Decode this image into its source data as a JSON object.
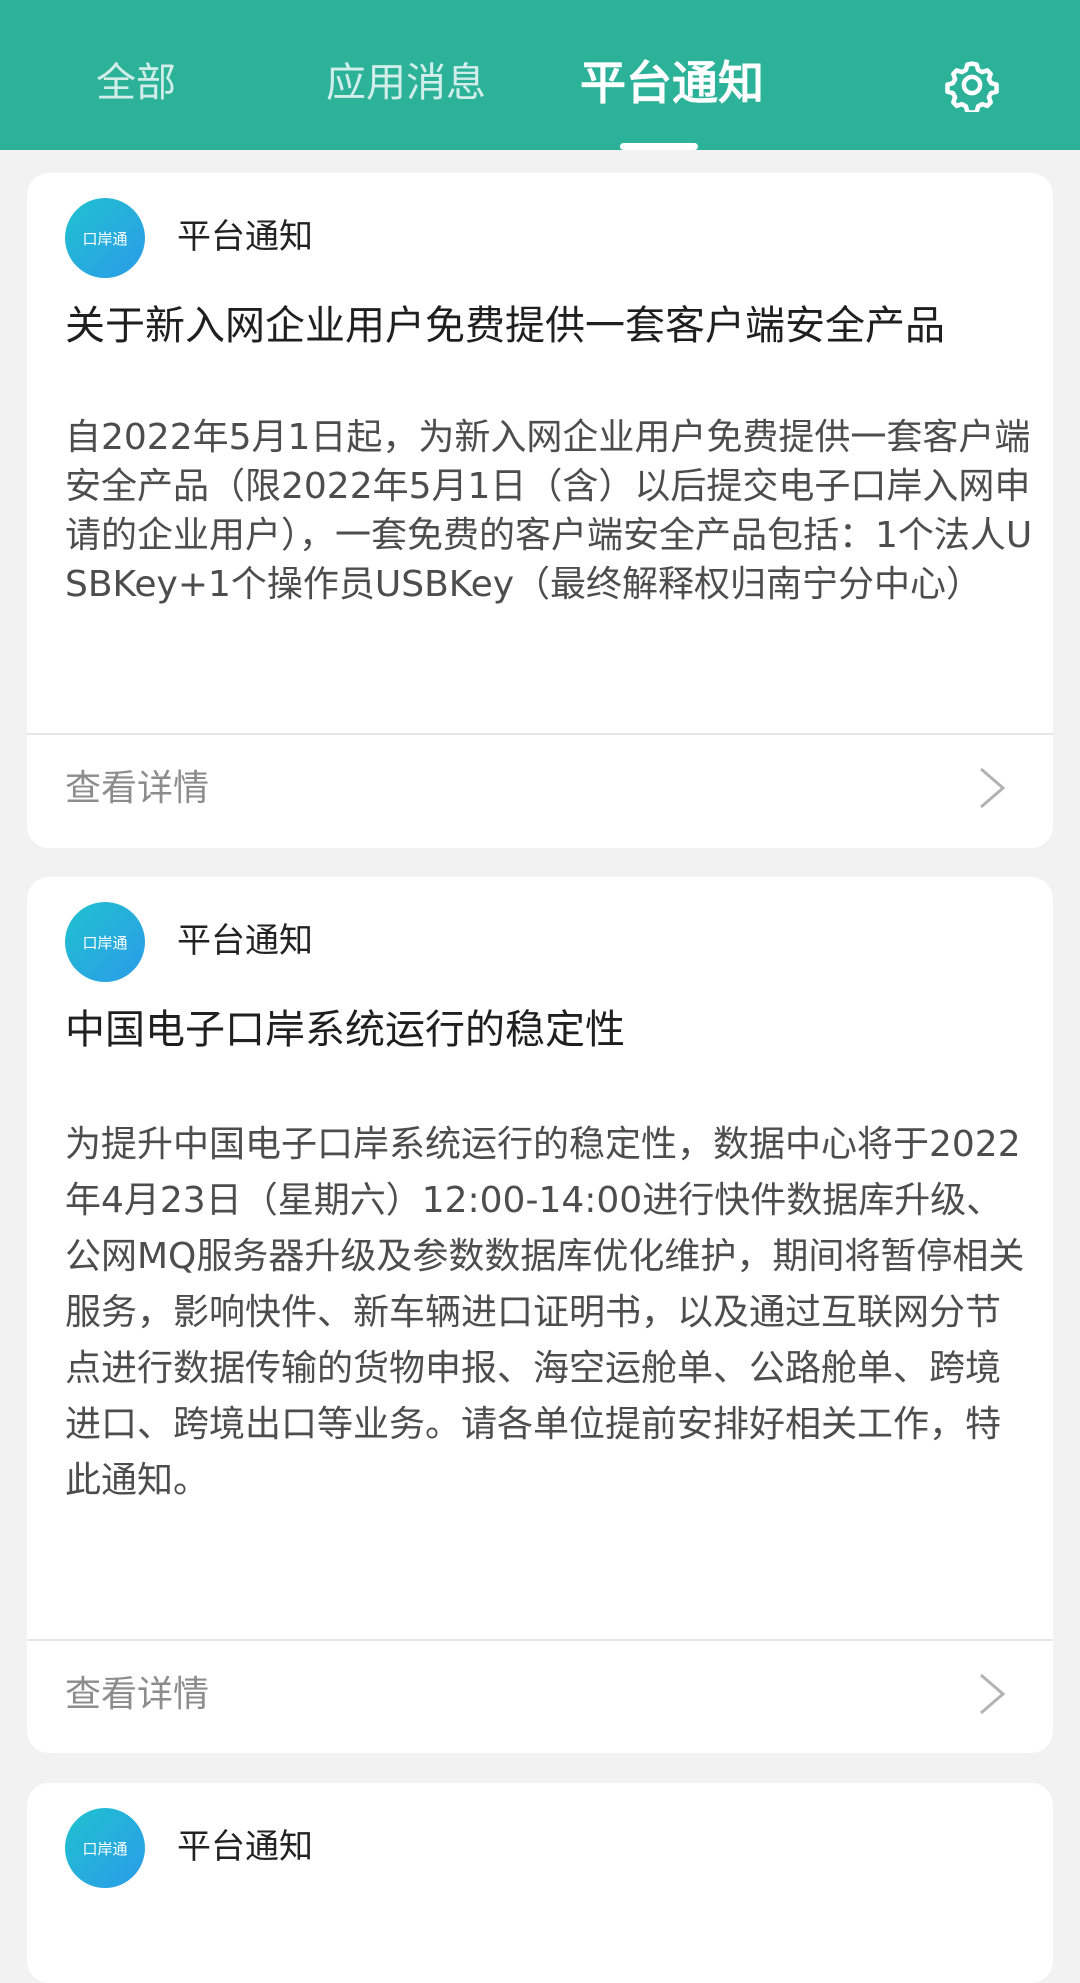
{
  "header": {
    "tabs": [
      {
        "label": "全部",
        "active": false
      },
      {
        "label": "应用消息",
        "active": false
      },
      {
        "label": "平台通知",
        "active": true
      }
    ],
    "settings_icon": "gear-icon",
    "background_color": "#2db29a"
  },
  "notifications": [
    {
      "avatar_icon": "kouantong-logo-icon",
      "avatar_text": "口岸通",
      "source": "平台通知",
      "title": "关于新入网企业用户免费提供一套客户端安全产品",
      "body": "自2022年5月1日起，为新入网企业用户免费提供一套客户端安全产品（限2022年5月1日（含）以后提交电子口岸入网申请的企业用户），一套免费的客户端安全产品包括：1个法人USBKey+1个操作员USBKey（最终解释权归南宁分中心）",
      "details_label": "查看详情"
    },
    {
      "avatar_icon": "kouantong-logo-icon",
      "avatar_text": "口岸通",
      "source": "平台通知",
      "title": "中国电子口岸系统运行的稳定性",
      "body": "为提升中国电子口岸系统运行的稳定性，数据中心将于2022年4月23日（星期六）12:00-14:00进行快件数据库升级、公网MQ服务器升级及参数数据库优化维护，期间将暂停相关服务，影响快件、新车辆进口证明书，以及通过互联网分节点进行数据传输的货物申报、海空运舱单、公路舱单、跨境进口、跨境出口等业务。请各单位提前安排好相关工作，特此通知。",
      "details_label": "查看详情"
    },
    {
      "avatar_icon": "kouantong-logo-icon",
      "avatar_text": "口岸通",
      "source": "平台通知"
    }
  ]
}
